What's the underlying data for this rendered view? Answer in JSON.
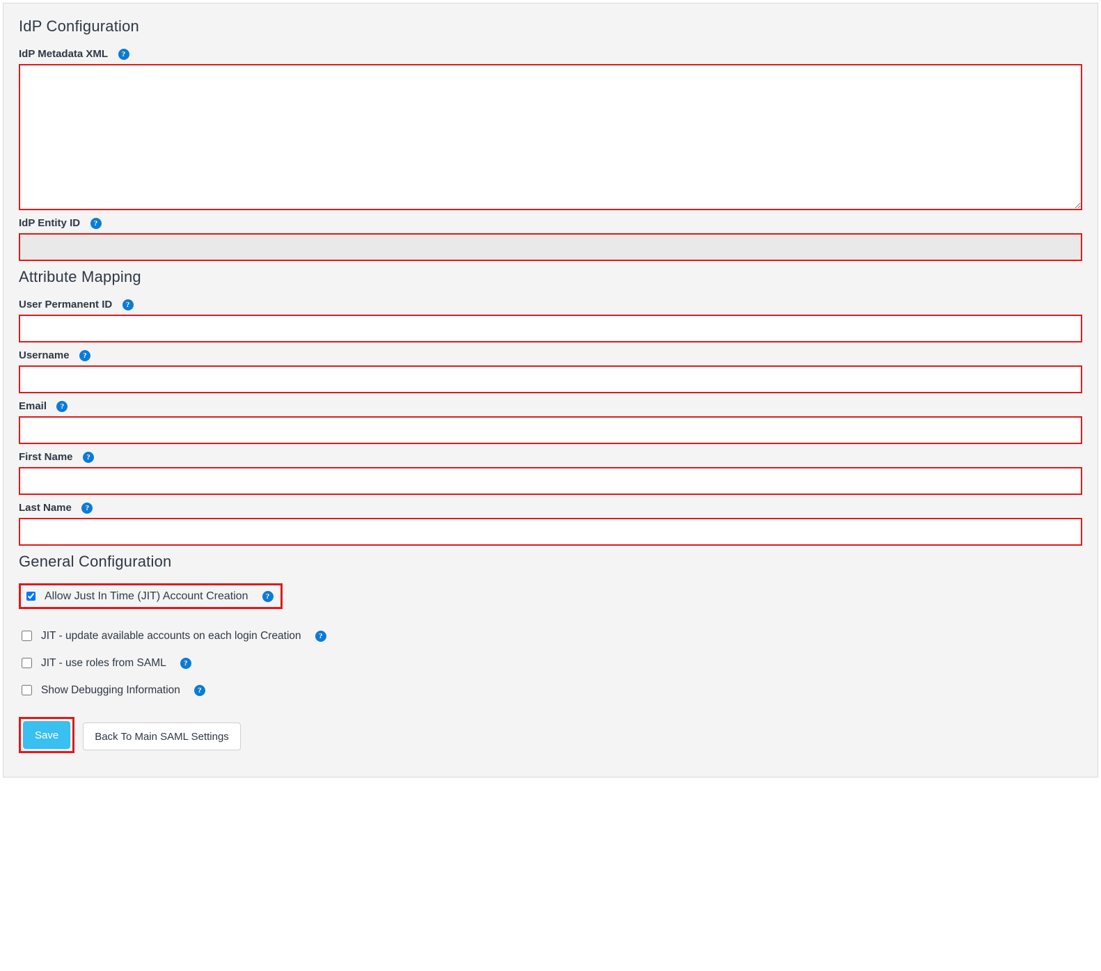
{
  "sections": {
    "idp": "IdP Configuration",
    "attr": "Attribute Mapping",
    "general": "General Configuration"
  },
  "fields": {
    "idp_metadata_xml": {
      "label": "IdP Metadata XML",
      "value": ""
    },
    "idp_entity_id": {
      "label": "IdP Entity ID",
      "value": ""
    },
    "user_permanent_id": {
      "label": "User Permanent ID",
      "value": ""
    },
    "username": {
      "label": "Username",
      "value": ""
    },
    "email": {
      "label": "Email",
      "value": ""
    },
    "first_name": {
      "label": "First Name",
      "value": ""
    },
    "last_name": {
      "label": "Last Name",
      "value": ""
    }
  },
  "checks": {
    "jit_create": {
      "label": "Allow Just In Time (JIT) Account Creation",
      "checked": true
    },
    "jit_update": {
      "label": "JIT - update available accounts on each login Creation",
      "checked": false
    },
    "jit_roles": {
      "label": "JIT - use roles from SAML",
      "checked": false
    },
    "show_debug": {
      "label": "Show Debugging Information",
      "checked": false
    }
  },
  "buttons": {
    "save": "Save",
    "back": "Back To Main SAML Settings"
  },
  "help_glyph": "?"
}
